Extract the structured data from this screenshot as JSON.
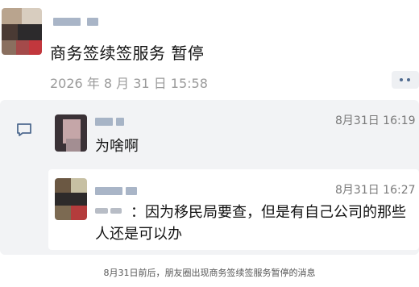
{
  "post": {
    "text": "商务签续签服务 暂停",
    "time": "2026 年 8 月 31 日 15:58"
  },
  "comments": [
    {
      "time": "8月31日 16:19",
      "text": "为啥啊"
    },
    {
      "time": "8月31日 16:27",
      "text": "：因为移民局要查，但是有自己公司的那些人还是可以办"
    }
  ],
  "caption": "8月31日前后，朋友圈出现商务签续签服务暂停的消息",
  "icons": {
    "more": "more-dots-icon",
    "comment": "comment-bubble-icon"
  },
  "colors": {
    "time_gray": "#9a9a9a",
    "comment_bg": "#f2f3f5",
    "link_blue": "#4f6a8f"
  }
}
